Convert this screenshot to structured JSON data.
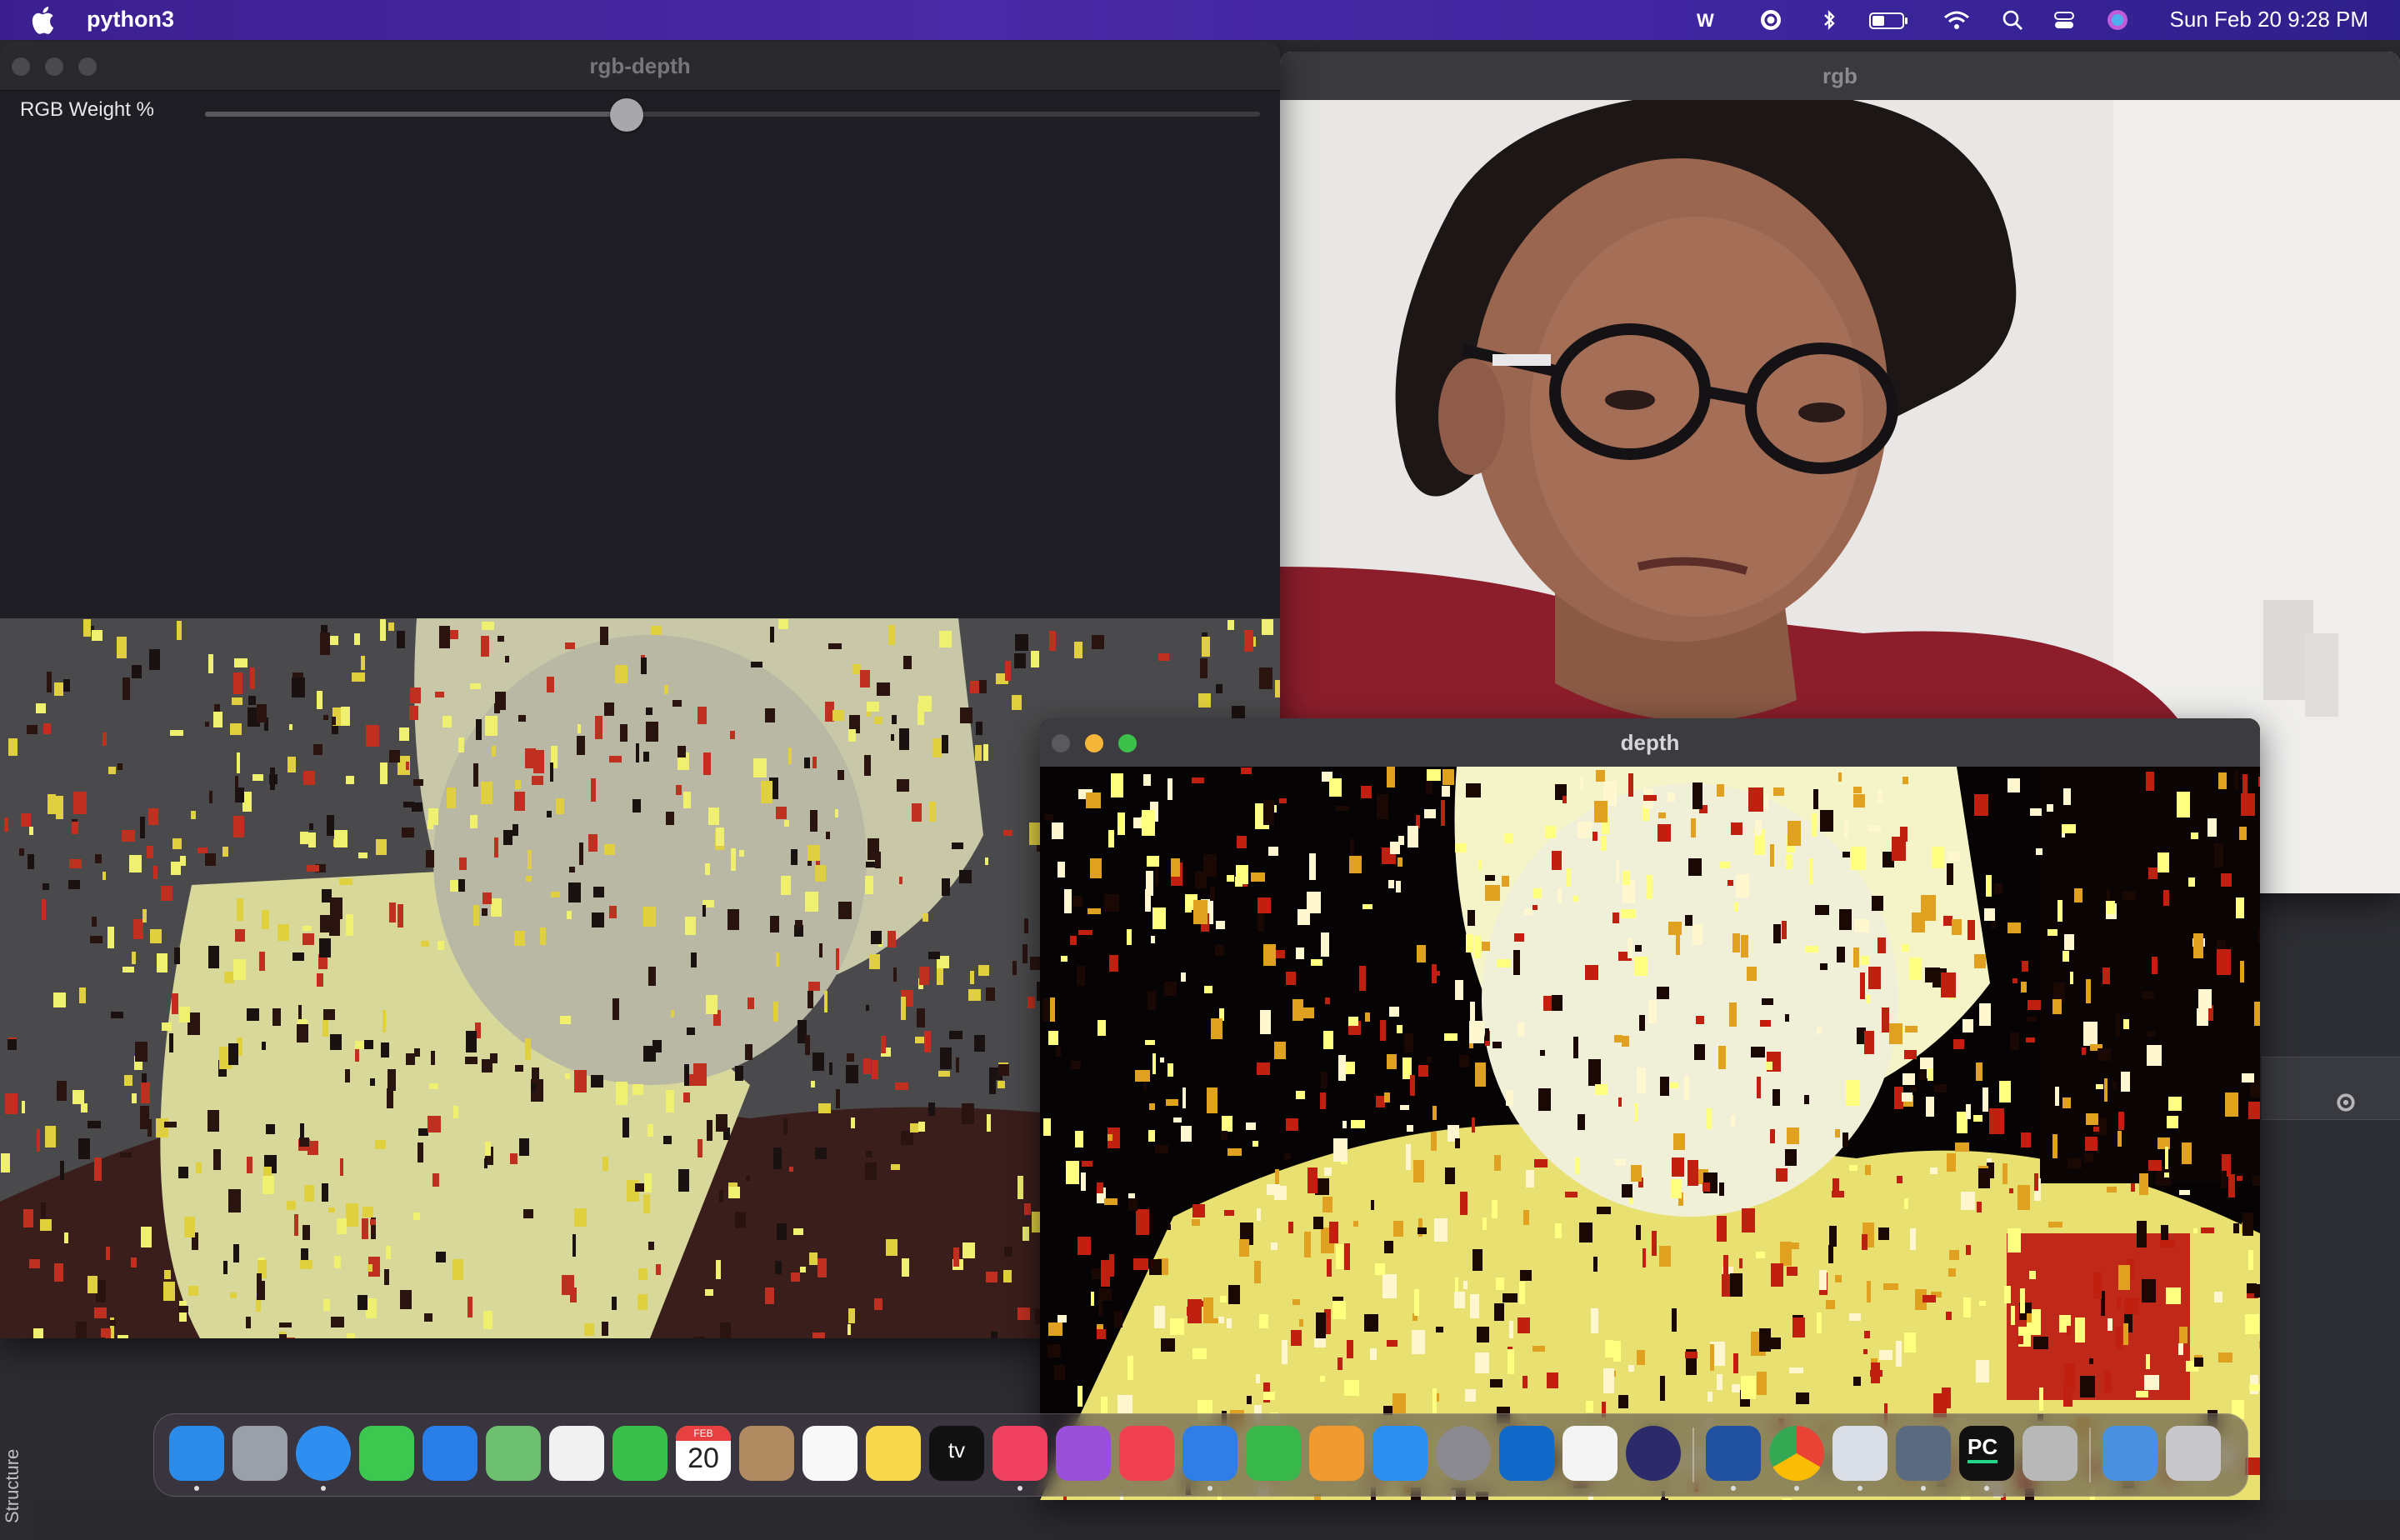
{
  "menubar": {
    "app_name": "python3",
    "clock": "Sun Feb 20  9:28 PM",
    "icons": [
      "apple-icon",
      "wordweb-icon",
      "grammarly-icon",
      "bluetooth-icon",
      "battery-icon",
      "wifi-icon",
      "spotlight-search-icon",
      "control-center-icon",
      "siri-icon"
    ]
  },
  "windows": {
    "rgb": {
      "title": "rgb"
    },
    "rgb_depth": {
      "title": "rgb-depth",
      "slider": {
        "label": "RGB Weight %",
        "value_fraction": 0.4
      }
    },
    "depth": {
      "title": "depth"
    }
  },
  "ide": {
    "structure_tab": "Structure"
  },
  "dock": {
    "apps": [
      "Finder",
      "Launchpad",
      "Safari",
      "Messages",
      "Mail",
      "Maps",
      "Photos",
      "FaceTime",
      "Calendar",
      "Contacts",
      "Reminders",
      "Notes",
      "TV",
      "Music",
      "Podcasts",
      "News",
      "Keynote",
      "Numbers",
      "Pages",
      "App Store",
      "System Preferences",
      "Outlook",
      "Google Play",
      "Eclipse",
      "WordWeb",
      "Chrome",
      "Preview",
      "QuickTime",
      "PyCharm",
      "Script Editor",
      "Downloads",
      "Trash"
    ],
    "calendar_month": "FEB",
    "calendar_day": "20",
    "tv_label": "tv",
    "pycharm_label": "PC"
  },
  "colors": {
    "menubar": "#3b1f8f",
    "depth_hot": "#ffff80",
    "depth_mid": "#e0a020",
    "depth_low": "#c02010"
  }
}
